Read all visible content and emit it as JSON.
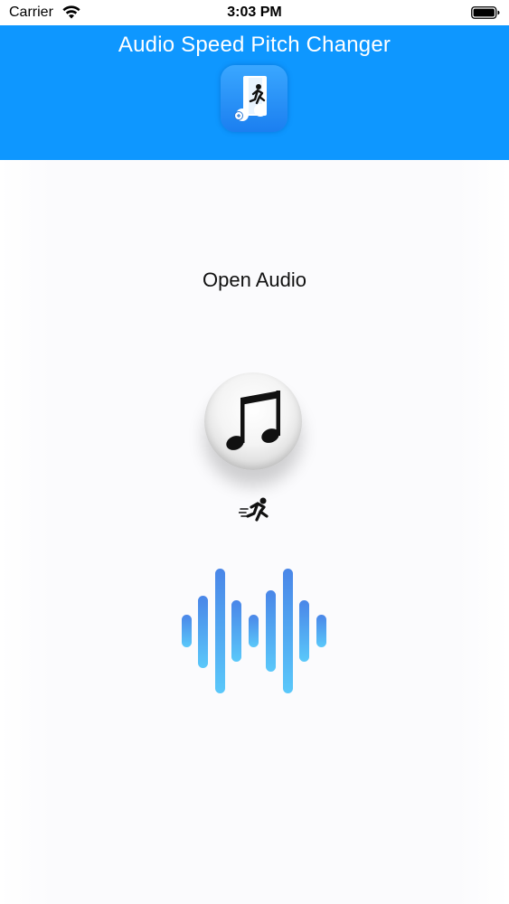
{
  "status_bar": {
    "carrier": "Carrier",
    "time": "3:03 PM",
    "wifi_icon": "wifi-icon",
    "battery_icon": "battery-icon"
  },
  "header": {
    "title": "Audio Speed Pitch Changer",
    "background": "#0e97ff",
    "app_icon": "music-note-runner-icon"
  },
  "main": {
    "open_audio_label": "Open Audio",
    "music_button_icon": "music-note-icon",
    "runner_icon": "runner-icon",
    "waveform_icon": "sound-wave-icon",
    "wave_colors": [
      "#4a86e8",
      "#5ac8fa"
    ]
  }
}
